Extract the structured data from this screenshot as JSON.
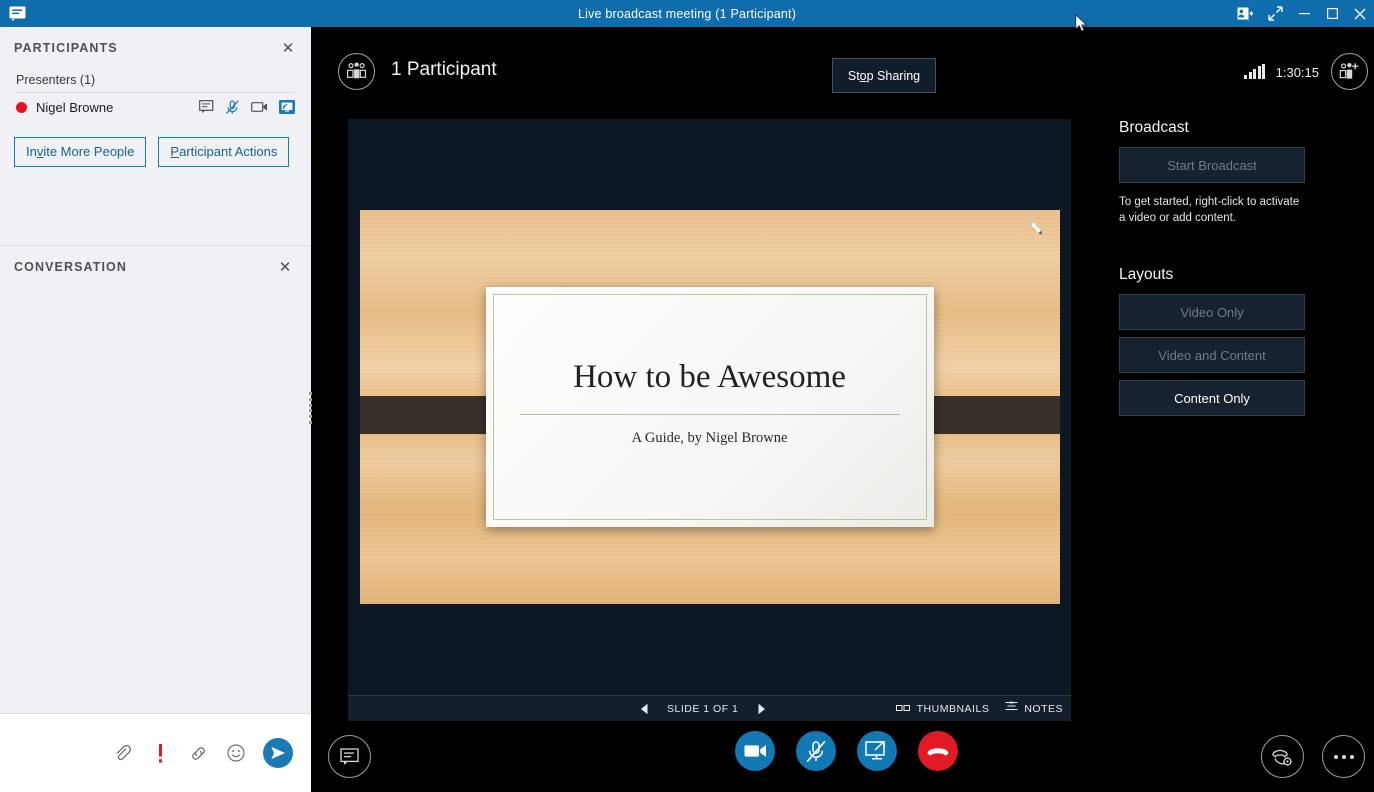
{
  "titlebar": {
    "title": "Live broadcast meeting (1 Participant)",
    "app_icon": "chat-bubble-icon",
    "controls": [
      {
        "name": "share-contact-icon",
        "glyph": "contact-card"
      },
      {
        "name": "expand-icon",
        "glyph": "diagonal-arrows"
      },
      {
        "name": "minimize-button",
        "glyph": "minimize"
      },
      {
        "name": "maximize-button",
        "glyph": "maximize"
      },
      {
        "name": "close-button",
        "glyph": "close"
      }
    ],
    "accent_color": "#0f6cad"
  },
  "participants_panel": {
    "header": "PARTICIPANTS",
    "close_label": "✕",
    "group_label": "Presenters (1)",
    "people": [
      {
        "name": "Nigel Browne",
        "status_color": "#e81123",
        "icons": [
          "chat-icon",
          "mic-muted-icon",
          "video-icon",
          "sharing-screen-icon"
        ]
      }
    ],
    "buttons": [
      {
        "name": "invite-more-people-button",
        "pre": "In",
        "accel": "v",
        "post": "ite More People"
      },
      {
        "name": "participant-actions-button",
        "pre": "",
        "accel": "P",
        "post": "articipant Actions"
      }
    ]
  },
  "conversation_panel": {
    "header": "CONVERSATION",
    "close_label": "✕",
    "footer_icons": [
      "attach-icon",
      "priority-icon",
      "link-icon",
      "emoji-icon"
    ],
    "send_icon": "send-icon",
    "priority_color": "#e01b24",
    "send_color": "#1b7ab5"
  },
  "topbar": {
    "people_icon": "people-group-icon",
    "participant_count": "1 Participant",
    "stop_sharing": {
      "pre": "St",
      "accel": "o",
      "post": "p Sharing"
    },
    "signal_icon": "signal-bars-icon",
    "timer": "1:30:15",
    "add_person_icon": "add-person-icon"
  },
  "slide": {
    "title": "How to be Awesome",
    "subtitle": "A Guide, by Nigel Browne",
    "annotate_icon": "pencil-icon",
    "background": "wood-texture"
  },
  "slide_nav": {
    "prev_icon": "prev-arrow-icon",
    "next_icon": "next-arrow-icon",
    "label": "SLIDE 1 OF 1",
    "thumbnails": {
      "icon": "thumbnails-icon",
      "label": "THUMBNAILS"
    },
    "notes": {
      "icon": "notes-icon",
      "label": "NOTES"
    }
  },
  "sidebar": {
    "broadcast_header": "Broadcast",
    "start_broadcast_label": "Start Broadcast",
    "start_broadcast_enabled": false,
    "help_text": "To get started, right-click to activate a video or add content.",
    "layouts_header": "Layouts",
    "layouts": [
      {
        "label": "Video Only",
        "enabled": false
      },
      {
        "label": "Video and Content",
        "enabled": false
      },
      {
        "label": "Content Only",
        "enabled": true
      }
    ]
  },
  "bottombar": {
    "chat_icon": "chat-bubble-icon",
    "center": [
      {
        "name": "video-button",
        "icon": "video-camera-icon",
        "style": "blue-filled"
      },
      {
        "name": "mic-button",
        "icon": "mic-muted-icon",
        "style": "blue-outline"
      },
      {
        "name": "present-button",
        "icon": "present-screen-icon",
        "style": "blue-outline"
      },
      {
        "name": "hangup-button",
        "icon": "hangup-phone-icon",
        "style": "red-filled"
      }
    ],
    "right": [
      {
        "name": "call-settings-button",
        "icon": "phone-gear-icon"
      },
      {
        "name": "more-options-button",
        "icon": "ellipsis-icon"
      }
    ]
  }
}
